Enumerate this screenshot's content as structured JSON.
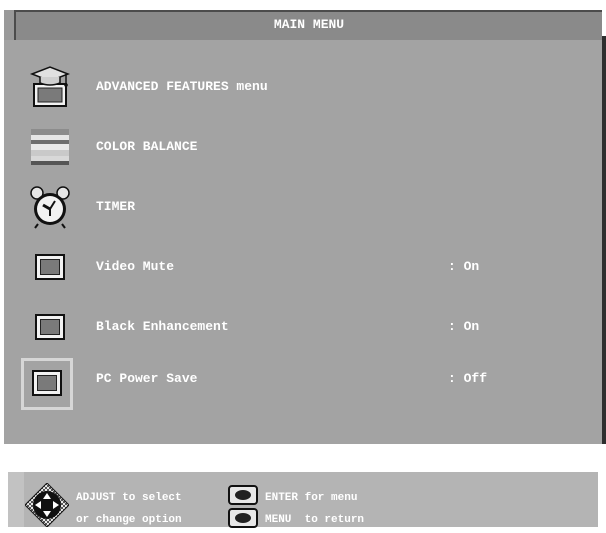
{
  "menu": {
    "title": "MAIN MENU",
    "items": [
      {
        "label": "ADVANCED FEATURES menu",
        "value": "",
        "icon": "graduation-cap-icon"
      },
      {
        "label": "COLOR BALANCE",
        "value": "",
        "icon": "color-bars-icon"
      },
      {
        "label": "TIMER",
        "value": "",
        "icon": "alarm-clock-icon"
      },
      {
        "label": "Video Mute",
        "value": ": On",
        "icon": "toggle-button-icon"
      },
      {
        "label": "Black Enhancement",
        "value": ": On",
        "icon": "toggle-button-icon"
      },
      {
        "label": "PC Power Save",
        "value": ": Off",
        "icon": "toggle-button-icon",
        "selected": true
      }
    ]
  },
  "help": {
    "adjust_line1": "ADJUST to select",
    "adjust_line2": "or change option",
    "enter_hint": "ENTER for menu",
    "menu_hint": "MENU  to return"
  },
  "colors": {
    "body_bg": "#a3a3a3",
    "title_bg": "#8a8a8a",
    "text": "#ffffff",
    "selection_frame": "#d6d6d6"
  }
}
